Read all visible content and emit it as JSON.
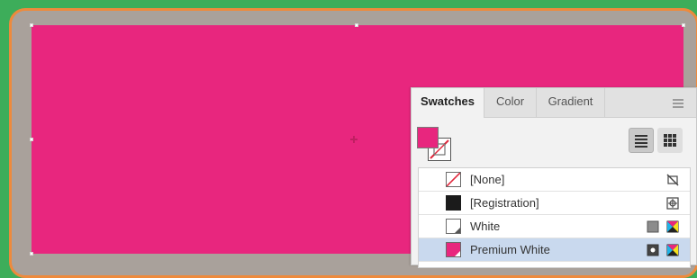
{
  "panel": {
    "tabs": [
      {
        "label": "Swatches",
        "active": true
      },
      {
        "label": "Color",
        "active": false
      },
      {
        "label": "Gradient",
        "active": false
      }
    ],
    "menu_icon": "hamburger-menu-icon",
    "fill_color": "#e8267e",
    "stroke": "none"
  },
  "swatches": [
    {
      "label": "[None]",
      "chip": "none",
      "icons": [
        "no-edit-icon"
      ]
    },
    {
      "label": "[Registration]",
      "chip": "#1b1b1b",
      "icons": [
        "registration-icon"
      ]
    },
    {
      "label": "White",
      "chip": "#ffffff",
      "icons": [
        "process-color-icon",
        "cmyk-icon"
      ]
    },
    {
      "label": "Premium White",
      "chip": "#e8267e",
      "icons": [
        "spot-color-icon",
        "cmyk-icon"
      ],
      "selected": true
    }
  ],
  "colors": {
    "canvas_fill": "#e8267e",
    "pasteboard": "#a9a19b",
    "frame_border": "#ee8a3c",
    "background": "#3dad5a",
    "selection_highlight": "#c9d9ee"
  }
}
